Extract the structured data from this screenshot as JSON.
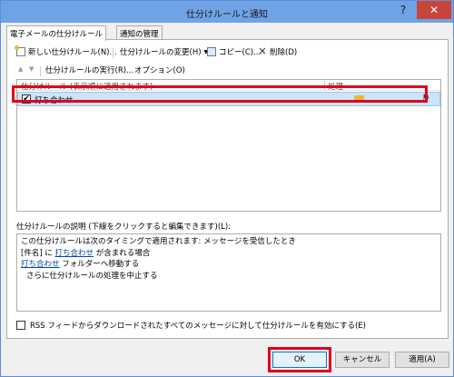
{
  "window": {
    "title": "仕分けルールと通知",
    "help": "?",
    "close": "✕"
  },
  "tabs": [
    {
      "label": "電子メールの仕分けルール"
    },
    {
      "label": "通知の管理"
    }
  ],
  "toolbar": {
    "new_rule": "新しい仕分けルール(N)...",
    "change_rule": "仕分けルールの変更(H)",
    "change_rule_arrow": "▼",
    "copy": "コピー(C)...",
    "delete": "削除(D)"
  },
  "row2": {
    "up": "▲",
    "down": "▼",
    "run_rules": "仕分けルールの実行(R)...",
    "options": "オプション(O)"
  },
  "list": {
    "col_rule": "仕分けルール (表示順に適用されます)",
    "col_action": "処理",
    "rows": [
      {
        "checked": "✔",
        "name": "打ち合わせ"
      }
    ]
  },
  "description": {
    "label": "仕分けルールの説明 (下線をクリックすると編集できます)(L):",
    "line1": "この仕分けルールは次のタイミングで適用されます: メッセージを受信したとき",
    "line2_pre": "[件名] に",
    "line2_link": "打ち合わせ",
    "line2_post": "が含まれる場合",
    "line3_link": "打ち合わせ",
    "line3_post": "フォルダーへ移動する",
    "line4": "さらに仕分けルールの処理を中止する"
  },
  "rss_checkbox": "RSS フィードからダウンロードされたすべてのメッセージに対して仕分けルールを有効にする(E)",
  "buttons": {
    "ok": "OK",
    "cancel": "キャンセル",
    "apply": "適用(A)"
  }
}
